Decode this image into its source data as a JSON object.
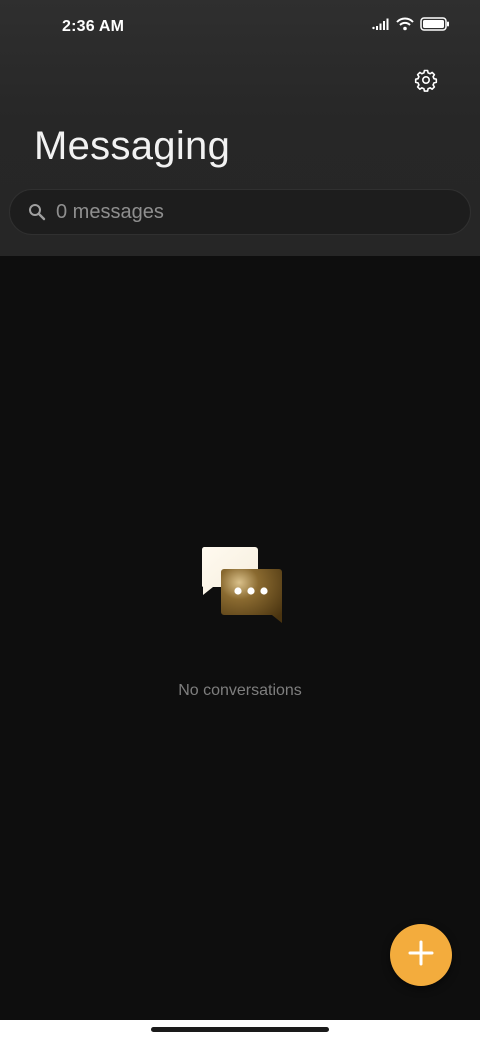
{
  "status_bar": {
    "time": "2:36 AM",
    "icons": [
      "signal-icon",
      "wifi-icon",
      "battery-icon"
    ]
  },
  "header": {
    "title": "Messaging",
    "settings_icon": "gear-icon"
  },
  "search": {
    "placeholder": "0 messages",
    "icon": "search-icon"
  },
  "empty_state": {
    "icon": "chat-bubbles-icon",
    "message": "No conversations"
  },
  "fab": {
    "icon": "plus-icon",
    "color": "#f3ac3d"
  },
  "colors": {
    "background": "#0e0e0e",
    "header_background": "#272727",
    "accent": "#f3ac3d"
  }
}
